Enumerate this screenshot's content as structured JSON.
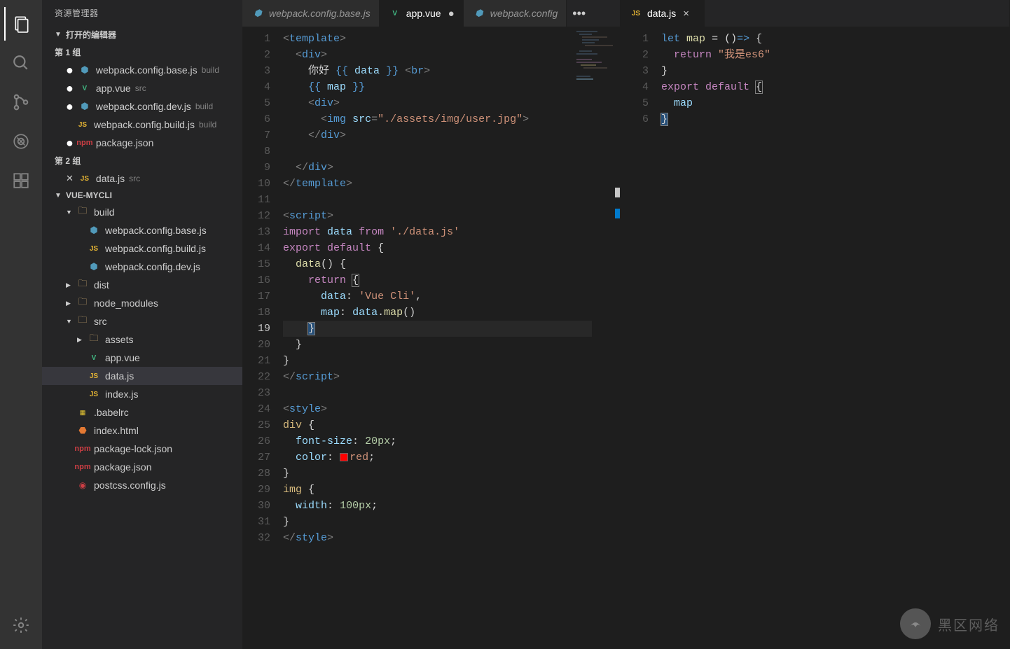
{
  "sidebar": {
    "title": "资源管理器",
    "openEditors": {
      "header": "打开的编辑器",
      "group1": "第 1 组",
      "group2": "第 2 组",
      "files1": [
        {
          "name": "webpack.config.base.js",
          "path": "build",
          "icon": "cfg",
          "dirty": true
        },
        {
          "name": "app.vue",
          "path": "src",
          "icon": "vue",
          "dirty": true
        },
        {
          "name": "webpack.config.dev.js",
          "path": "build",
          "icon": "cfg",
          "dirty": true
        },
        {
          "name": "webpack.config.build.js",
          "path": "build",
          "icon": "js",
          "dirty": false
        },
        {
          "name": "package.json",
          "path": "",
          "icon": "pkg",
          "dirty": true
        }
      ],
      "files2": [
        {
          "name": "data.js",
          "path": "src",
          "icon": "js",
          "close": true
        }
      ]
    },
    "project": {
      "header": "VUE-MYCLI",
      "tree": [
        {
          "pad": 1,
          "tw": "▼",
          "icon": "folder",
          "label": "build"
        },
        {
          "pad": 2,
          "icon": "cfg",
          "label": "webpack.config.base.js"
        },
        {
          "pad": 2,
          "icon": "js",
          "label": "webpack.config.build.js"
        },
        {
          "pad": 2,
          "icon": "cfg",
          "label": "webpack.config.dev.js"
        },
        {
          "pad": 1,
          "tw": "▶",
          "icon": "folder",
          "label": "dist"
        },
        {
          "pad": 1,
          "tw": "▶",
          "icon": "folder",
          "label": "node_modules"
        },
        {
          "pad": 1,
          "tw": "▼",
          "icon": "folder",
          "label": "src"
        },
        {
          "pad": 2,
          "tw": "▶",
          "icon": "folder",
          "label": "assets"
        },
        {
          "pad": 2,
          "icon": "vue",
          "label": "app.vue"
        },
        {
          "pad": 2,
          "icon": "js",
          "label": "data.js",
          "sel": true
        },
        {
          "pad": 2,
          "icon": "js",
          "label": "index.js"
        },
        {
          "pad": 1,
          "icon": "babel",
          "label": ".babelrc"
        },
        {
          "pad": 1,
          "icon": "html",
          "label": "index.html"
        },
        {
          "pad": 1,
          "icon": "pkg",
          "label": "package-lock.json"
        },
        {
          "pad": 1,
          "icon": "pkg",
          "label": "package.json"
        },
        {
          "pad": 1,
          "icon": "postcss",
          "label": "postcss.config.js"
        }
      ]
    }
  },
  "tabs1": [
    {
      "icon": "cfg",
      "label": "webpack.config.base.js"
    },
    {
      "icon": "vue",
      "label": "app.vue",
      "active": true,
      "dirty": true
    },
    {
      "icon": "cfg",
      "label": "webpack.config"
    }
  ],
  "tabs2": [
    {
      "icon": "js",
      "label": "data.js",
      "active": true,
      "close": true
    }
  ],
  "editor1": {
    "lines": 32,
    "current": 19
  },
  "editor2": {
    "lines": 6
  },
  "code1_text": {
    "t1": "template",
    "t2": "div",
    "t3": "你好 ",
    "t4": "data",
    "t5": "br",
    "t6": "map",
    "t7": "img",
    "t8": "src",
    "t9": "\"./assets/img/user.jpg\"",
    "t10": "script",
    "t11": "import",
    "t12": "data",
    "t13": "from",
    "t14": "'./data.js'",
    "t15": "export",
    "t16": "default",
    "t17": "data",
    "t18": "return",
    "t19": "data",
    "t20": "'Vue Cli'",
    "t21": "map",
    "t22": "data",
    "t23": "map",
    "t24": "style",
    "t25": "div",
    "t26": "font-size",
    "t27": "20px",
    "t28": "color",
    "t29": "red",
    "t30": "img",
    "t31": "width",
    "t32": "100px"
  },
  "code2_text": {
    "t1": "let",
    "t2": "map",
    "t3": "return",
    "t4": "\"我是es6\"",
    "t5": "export",
    "t6": "default",
    "t7": "map"
  },
  "watermark": "黑区网络"
}
